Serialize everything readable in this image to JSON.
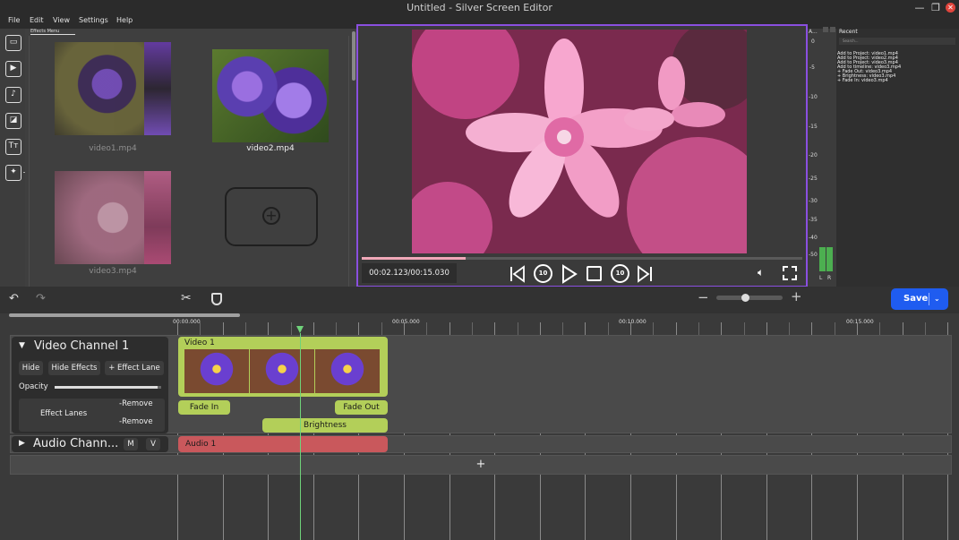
{
  "window": {
    "title": "Untitled - Silver Screen Editor"
  },
  "menu": [
    "File",
    "Edit",
    "View",
    "Settings",
    "Help"
  ],
  "media": {
    "tab_label": "Effects Menu",
    "items": [
      {
        "label": "video1.mp4"
      },
      {
        "label": "video2.mp4"
      },
      {
        "label": "video3.mp4"
      }
    ],
    "add_icon": "plus-icon"
  },
  "preview": {
    "timecode": "00:02.123/00:15.030",
    "progress": 0.235
  },
  "meters": {
    "header": "A...",
    "scale": [
      "0",
      "-5",
      "-10",
      "-15",
      "-20",
      "-25",
      "-30",
      "-35",
      "-40",
      "-50"
    ],
    "left": "L",
    "right": "R"
  },
  "recent": {
    "title": "Recent",
    "search_placeholder": "Search...",
    "items": [
      "Add to Project: video1.mp4",
      "Add to Project: video2.mp4",
      "Add to Project: video3.mp4",
      "Add to timeline: video3.mp4",
      "+ Fade Out: video3.mp4",
      "+ Brightness: video3.mp4",
      "+ Fade In: video3.mp4"
    ]
  },
  "toolbar": {
    "save_label": "Save",
    "zoom": 0.43
  },
  "ruler": [
    "00:00.000",
    "00:05.000",
    "00:10.000",
    "00:15.000"
  ],
  "video_channel": {
    "name": "Video Channel 1",
    "hide": "Hide",
    "hide_effects": "Hide Effects",
    "effect_lane": "+ Effect Lane",
    "opacity_label": "Opacity",
    "opacity": 0.97,
    "effect_lanes_label": "Effect Lanes",
    "remove1": "-Remove",
    "remove2": "-Remove"
  },
  "audio_channel": {
    "name": "Audio Chann...",
    "m": "M",
    "v": "V"
  },
  "clips": {
    "video": "Video 1",
    "fade_in": "Fade In",
    "fade_out": "Fade Out",
    "brightness": "Brightness",
    "audio": "Audio 1"
  },
  "add_channel": "+",
  "colors": {
    "accent": "#8a4fe0",
    "save": "#1f5cf0",
    "clip": "#b3cf59",
    "audio_clip": "#c9585c",
    "playhead": "#6fd37a"
  }
}
